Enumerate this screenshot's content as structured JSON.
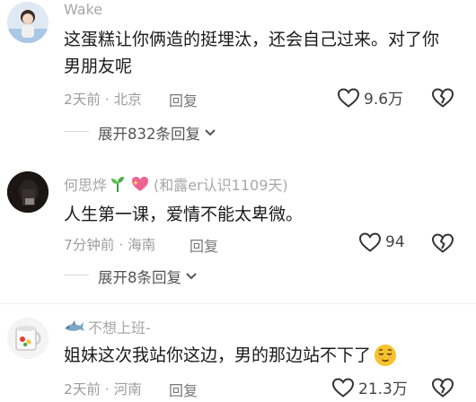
{
  "comments": [
    {
      "username": "Wake",
      "text": "这蛋糕让你俩造的挺埋汰，还会自己过来。对了你男朋友呢",
      "time": "2天前",
      "location": "北京",
      "reply_label": "回复",
      "likes": "9.6万",
      "expand_label": "展开832条回复"
    },
    {
      "username": "何思烨",
      "badge": "(和露er认识1109天)",
      "text": "人生第一课，爱情不能太卑微。",
      "time": "7分钟前",
      "location": "海南",
      "reply_label": "回复",
      "likes": "94",
      "expand_label": "展开8条回复"
    },
    {
      "username": "不想上班-",
      "text": "姐妹这次我站你这边，男的那边站不下了",
      "time": "2天前",
      "location": "河南",
      "reply_label": "回复",
      "likes": "21.3万"
    }
  ],
  "meta_separator": "·"
}
